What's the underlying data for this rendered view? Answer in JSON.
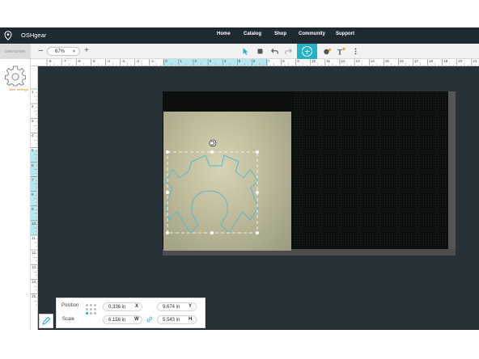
{
  "nav": {
    "brand": "OSHgear",
    "links": [
      "Home",
      "Catalog",
      "Shop",
      "Community",
      "Support"
    ]
  },
  "toolbar": {
    "machine_label": "UNKNOWN",
    "zoom_minus": "−",
    "zoom_value": "67%",
    "zoom_plus": "+",
    "accent_color": "#25b1c6"
  },
  "sidebar": {
    "laser_settings_label": "laser settings"
  },
  "ruler": {
    "top_labels": [
      "-8",
      "-7",
      "-6",
      "-5",
      "-4",
      "-3",
      "-2",
      "-1",
      "0",
      "1",
      "2",
      "3",
      "4",
      "5",
      "6",
      "7",
      "8",
      "9",
      "10",
      "11",
      "12",
      "13",
      "14",
      "15",
      "16",
      "17",
      "18",
      "19",
      "20",
      "21"
    ],
    "left_labels": [
      "1",
      "2",
      "3",
      "4",
      "5",
      "6",
      "7",
      "8",
      "9",
      "10",
      "11",
      "12",
      "13",
      "14",
      "15"
    ]
  },
  "position_panel": {
    "position_label": "Position",
    "scale_label": "Scale",
    "x_value": "0.336 in",
    "x_axis": "X",
    "y_value": "9.674 in",
    "y_axis": "Y",
    "w_value": "6.156 in",
    "w_axis": "W",
    "h_value": "5.543 in",
    "h_axis": "H"
  }
}
